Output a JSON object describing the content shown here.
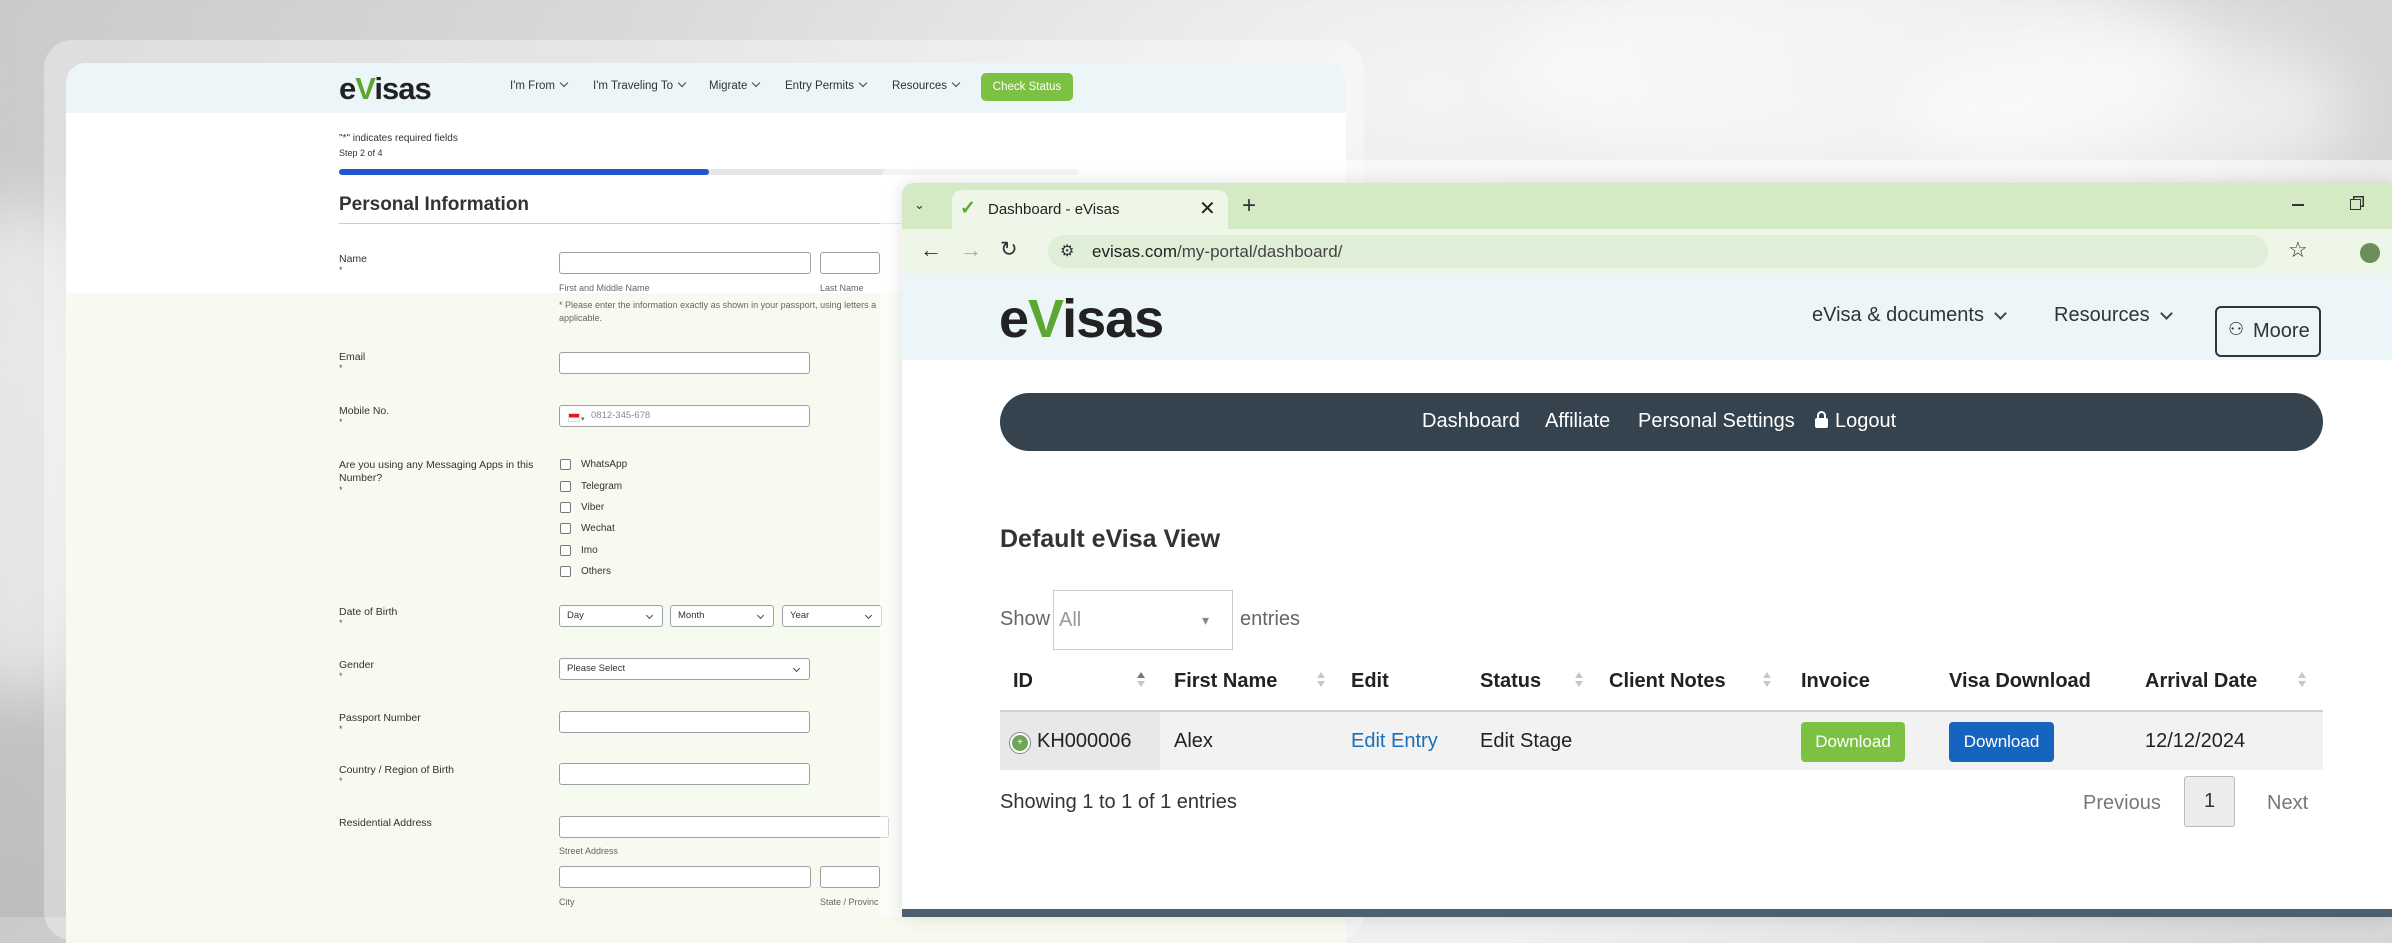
{
  "form_page": {
    "logo": {
      "part1": "e",
      "v": "V",
      "part2": "isas"
    },
    "nav": [
      "I'm From",
      "I'm Traveling To",
      "Migrate",
      "Entry Permits",
      "Resources"
    ],
    "check_status_label": "Check Status",
    "required_note": "\"*\" indicates required fields",
    "step": "Step 2 of 4",
    "progress_fraction": 0.5,
    "section_title": "Personal Information",
    "required_mark": "*",
    "name_label": "Name",
    "first_middle_sublabel": "First and Middle Name",
    "last_name_sublabel": "Last Name",
    "name_hint_line1": "* Please enter the information exactly as shown in your passport, using letters a",
    "name_hint_line2": "applicable.",
    "email_label": "Email",
    "mobile_label": "Mobile No.",
    "mobile_placeholder": "0812-345-678",
    "messaging_label_line1": "Are you using any Messaging Apps in this",
    "messaging_label_line2": "Number?",
    "messaging_apps": [
      "WhatsApp",
      "Telegram",
      "Viber",
      "Wechat",
      "Imo",
      "Others"
    ],
    "dob_label": "Date of Birth",
    "dob_selects": [
      "Day",
      "Month",
      "Year"
    ],
    "gender_label": "Gender",
    "gender_placeholder": "Please Select",
    "passport_label": "Passport Number",
    "country_label": "Country / Region of Birth",
    "address_label": "Residential Address",
    "street_sublabel": "Street Address",
    "city_sublabel": "City",
    "state_sublabel": "State / Provinc"
  },
  "browser": {
    "tab_title": "Dashboard - eVisas",
    "url_domain": "evisas.com",
    "url_path": "/my-portal/dashboard/",
    "site": {
      "logo": {
        "part1": "e",
        "v": "V",
        "part2": "isas"
      },
      "nav": [
        "eVisa & documents",
        "Resources"
      ],
      "user_label": "Moore"
    },
    "dashboard_nav": [
      "Dashboard",
      "Affiliate",
      "Personal Settings",
      "Logout"
    ],
    "section_title": "Default eVisa View",
    "show_label": "Show",
    "entries_label": "entries",
    "entries_select_value": "All",
    "table": {
      "headers": [
        "ID",
        "First Name",
        "Edit",
        "Status",
        "Client Notes",
        "Invoice",
        "Visa Download",
        "Arrival Date"
      ],
      "row": {
        "id": "KH000006",
        "first_name": "Alex",
        "edit": "Edit Entry",
        "status": "Edit Stage",
        "client_notes": "",
        "invoice_label": "Download",
        "visa_download_label": "Download",
        "arrival_date": "12/12/2024"
      }
    },
    "showing_text": "Showing 1 to 1 of 1 entries",
    "pagination": {
      "previous": "Previous",
      "current": "1",
      "next": "Next"
    }
  },
  "colors": {
    "brand_green": "#7cc142",
    "logo_v": "#5ba72f",
    "nav_dark": "#35434f",
    "link_blue": "#1a6fb8",
    "visa_btn": "#1565c0",
    "progress": "#2255cc"
  }
}
